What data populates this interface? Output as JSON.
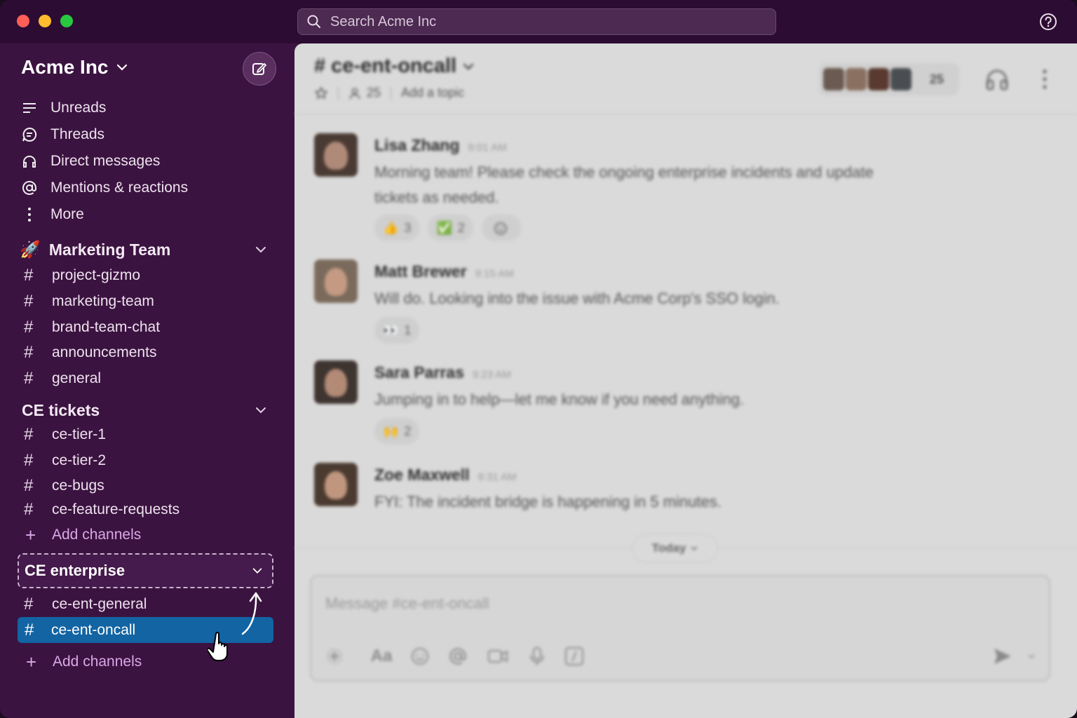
{
  "search": {
    "placeholder": "Search Acme Inc"
  },
  "workspace": {
    "name": "Acme Inc"
  },
  "nav": [
    {
      "label": "Unreads",
      "icon": "unreads-icon"
    },
    {
      "label": "Threads",
      "icon": "threads-icon"
    },
    {
      "label": "Direct messages",
      "icon": "direct-messages-icon"
    },
    {
      "label": "Mentions & reactions",
      "icon": "mention-icon"
    },
    {
      "label": "More",
      "icon": "more-vertical-icon"
    }
  ],
  "sections": {
    "marketing": {
      "title": "Marketing Team",
      "channels": [
        "project-gizmo",
        "marketing-team",
        "brand-team-chat",
        "announcements",
        "general"
      ]
    },
    "ce_tickets": {
      "title": "CE tickets",
      "channels": [
        "ce-tier-1",
        "ce-tier-2",
        "ce-bugs",
        "ce-feature-requests"
      ],
      "add_label": "Add channels"
    },
    "ce_enterprise": {
      "title": "CE enterprise",
      "channels": [
        "ce-ent-general",
        "ce-ent-oncall"
      ],
      "add_label": "Add channels"
    }
  },
  "channel_header": {
    "name": "# ce-ent-oncall",
    "member_count": "25",
    "topic_placeholder": "Add a topic",
    "members_badge": "25"
  },
  "messages": [
    {
      "author": "Lisa Zhang",
      "time": "9:01 AM",
      "text": "Morning team! Please check the ongoing enterprise incidents and update tickets as needed.",
      "reactions": [
        {
          "emoji": "👍",
          "count": "3"
        },
        {
          "emoji": "✅",
          "count": "2"
        }
      ]
    },
    {
      "author": "Matt Brewer",
      "time": "9:15 AM",
      "text": "Will do. Looking into the issue with Acme Corp's SSO login.",
      "reactions": [
        {
          "emoji": "👀",
          "count": "1"
        }
      ]
    },
    {
      "author": "Sara Parras",
      "time": "9:23 AM",
      "text": "Jumping in to help—let me know if you need anything.",
      "reactions": [
        {
          "emoji": "🙌",
          "count": "2"
        }
      ]
    },
    {
      "author": "Zoe Maxwell",
      "time": "9:31 AM",
      "text": "FYI: The incident bridge is happening in 5 minutes.",
      "reactions": []
    }
  ],
  "divider": {
    "label": "Today"
  },
  "composer": {
    "placeholder": "Message #ce-ent-oncall"
  },
  "colors": {
    "sidebar": "#3b1340",
    "active": "#1264a3",
    "add_link": "#d9a8e6"
  }
}
